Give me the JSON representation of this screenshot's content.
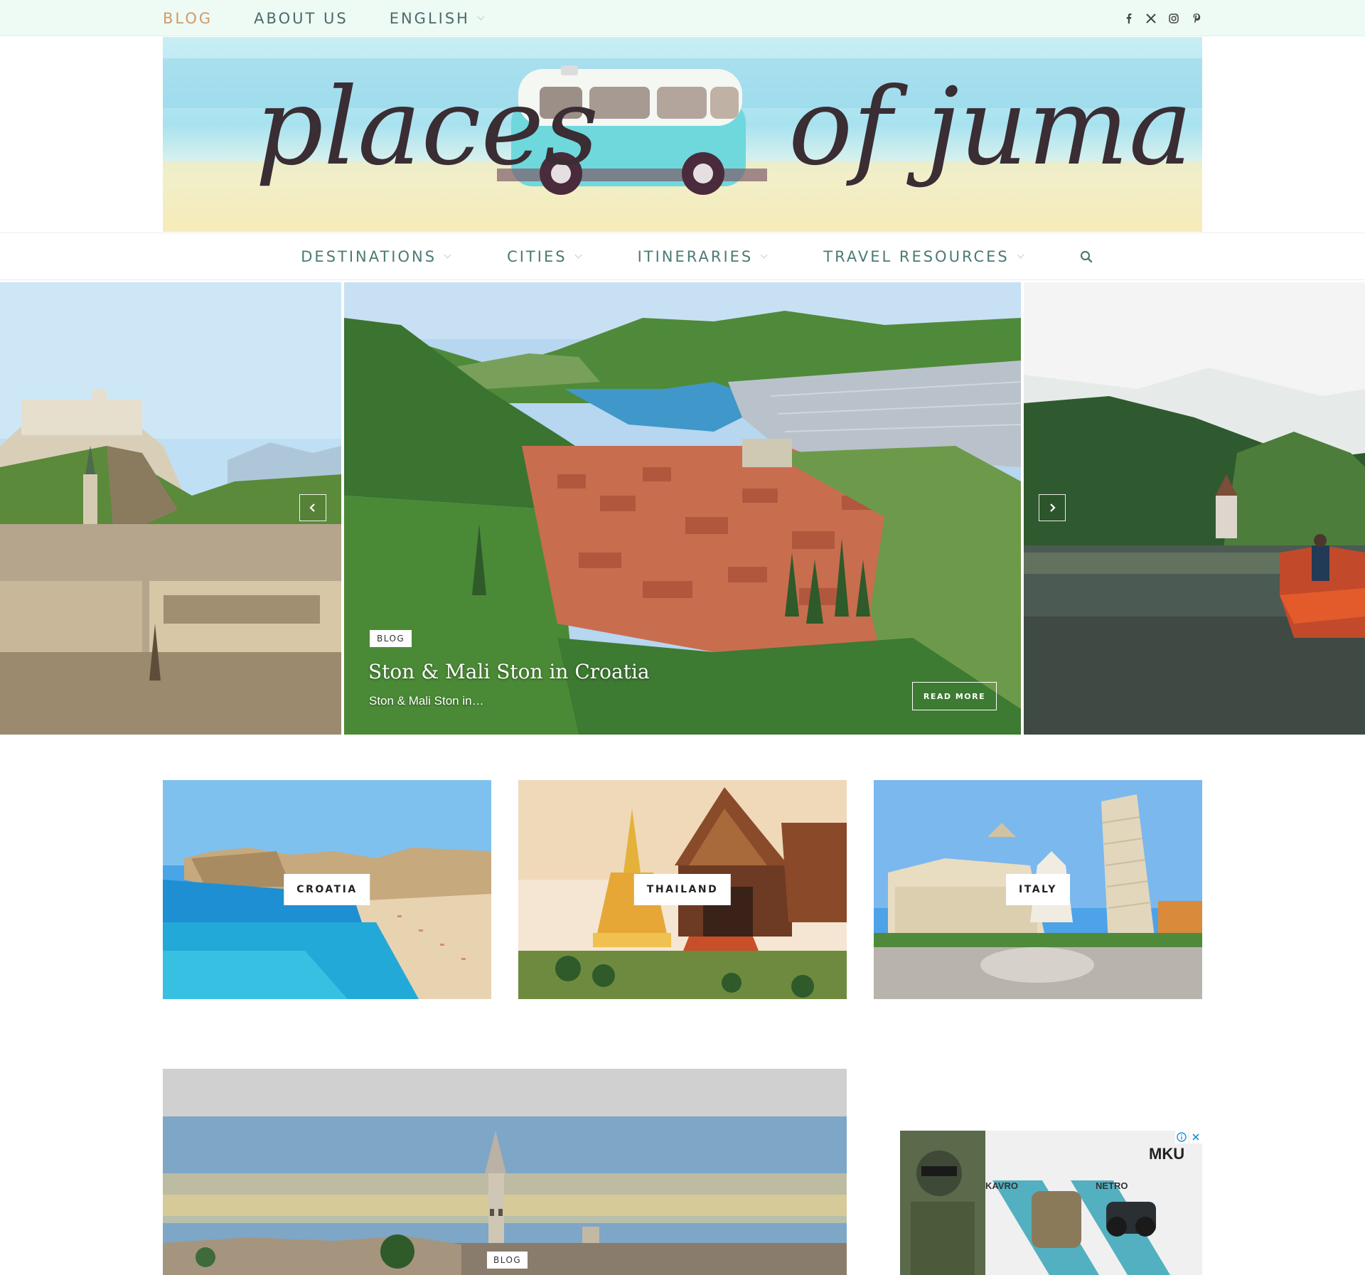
{
  "topbar": {
    "nav": [
      {
        "label": "BLOG",
        "active": true
      },
      {
        "label": "ABOUT US",
        "active": false
      },
      {
        "label": "ENGLISH",
        "dropdown": true
      }
    ],
    "social": [
      "facebook-icon",
      "x-icon",
      "instagram-icon",
      "pinterest-icon"
    ]
  },
  "logo": {
    "word1": "places",
    "word2": "of juma"
  },
  "mainnav": {
    "items": [
      {
        "label": "DESTINATIONS"
      },
      {
        "label": "CITIES"
      },
      {
        "label": "ITINERARIES"
      },
      {
        "label": "TRAVEL RESOURCES"
      }
    ],
    "search_icon": "search-icon"
  },
  "slider": {
    "tag": "BLOG",
    "title": "Ston & Mali Ston in Croatia",
    "excerpt": "Ston & Mali Ston in…",
    "read_more": "READ MORE"
  },
  "cards": [
    {
      "label": "CROATIA"
    },
    {
      "label": "THAILAND"
    },
    {
      "label": "ITALY"
    }
  ],
  "post": {
    "tag": "BLOG"
  },
  "ad": {
    "brand": "MKU",
    "product1": "KAVRO",
    "product2": "NETRO"
  },
  "colors": {
    "topbar_bg": "#eefaf4",
    "active_nav": "#d29a6a",
    "nav_text": "#4b7a74"
  }
}
